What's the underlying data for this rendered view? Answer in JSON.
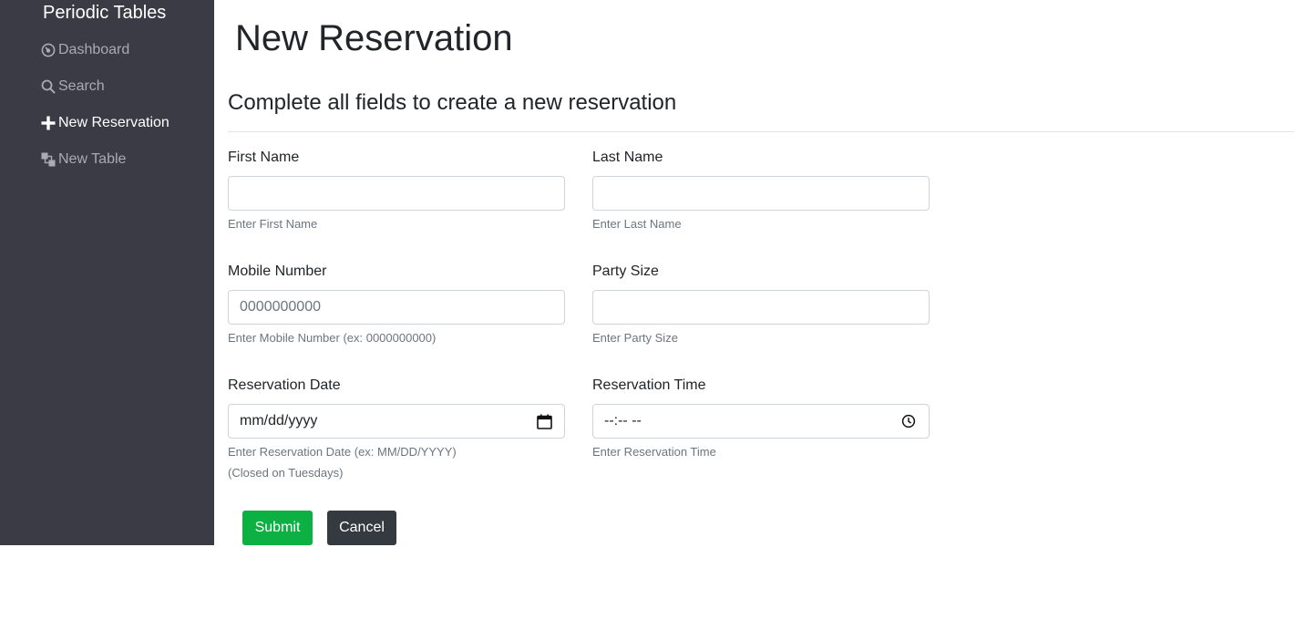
{
  "sidebar": {
    "brand": "Periodic Tables",
    "items": [
      {
        "label": "Dashboard",
        "icon": "dashboard-icon"
      },
      {
        "label": "Search",
        "icon": "search-icon"
      },
      {
        "label": "New Reservation",
        "icon": "plus-icon"
      },
      {
        "label": "New Table",
        "icon": "layers-icon"
      }
    ]
  },
  "main": {
    "title": "New Reservation",
    "subtitle": "Complete all fields to create a new reservation"
  },
  "form": {
    "first_name": {
      "label": "First Name",
      "value": "",
      "help": "Enter First Name"
    },
    "last_name": {
      "label": "Last Name",
      "value": "",
      "help": "Enter Last Name"
    },
    "mobile_number": {
      "label": "Mobile Number",
      "placeholder": "0000000000",
      "help": "Enter Mobile Number (ex: 0000000000)"
    },
    "party_size": {
      "label": "Party Size",
      "value": "",
      "help": "Enter Party Size"
    },
    "reservation_date": {
      "label": "Reservation Date",
      "display": "mm/dd/yyyy",
      "help": "Enter Reservation Date (ex: MM/DD/YYYY)",
      "help2": "(Closed on Tuesdays)"
    },
    "reservation_time": {
      "label": "Reservation Time",
      "display": "--:-- --",
      "help": "Enter Reservation Time"
    }
  },
  "buttons": {
    "submit": "Submit",
    "cancel": "Cancel"
  },
  "colors": {
    "sidebar_bg": "#3b3b46",
    "submit_bg": "#0cb043",
    "cancel_bg": "#343a40"
  }
}
